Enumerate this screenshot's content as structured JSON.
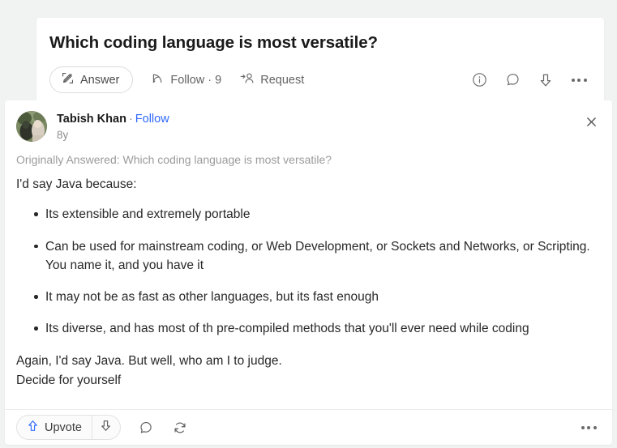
{
  "question": {
    "title": "Which coding language is most versatile?",
    "answer_button": {
      "label": "Answer",
      "icon": "pencil-edit-icon"
    },
    "follow": {
      "label": "Follow · 9",
      "icon": "rss-follow-icon",
      "count": "9"
    },
    "request": {
      "label": "Request",
      "icon": "person-add-request-icon"
    },
    "icons": {
      "info": "info-circle-icon",
      "comment": "comment-bubble-icon",
      "downvote": "downvote-arrow-icon",
      "more": "more-options-icon"
    }
  },
  "answer": {
    "author": {
      "name": "Tabish Khan",
      "separator": "·",
      "follow_label": "Follow",
      "timestamp": "8y",
      "avatar": "user-photo-avatar"
    },
    "close_icon": "close-icon",
    "originally_answered": "Originally Answered: Which coding language is most versatile?",
    "intro": "I'd say Java because:",
    "bullets": [
      "Its extensible and extremely portable",
      "Can be used for mainstream coding, or Web Development, or Sockets and Networks, or Scripting. You name it, and you have it",
      "It may not be as fast as other languages, but its fast enough",
      "Its diverse, and has most of th pre-compiled methods that you'll ever need while coding"
    ],
    "closing_line_1": "Again, I'd say Java. But well, who am I to judge.",
    "closing_line_2": "Decide for yourself",
    "footer": {
      "upvote_label": "Upvote",
      "upvote_icon": "upvote-arrow-icon",
      "downvote_icon": "downvote-arrow-icon",
      "comment_icon": "comment-bubble-icon",
      "share_icon": "repost-share-icon",
      "more_icon": "more-options-icon"
    }
  },
  "colors": {
    "page_background": "#f1f2f2",
    "card_background": "#ffffff",
    "link_blue": "#2e69ff",
    "upvote_blue": "#2e69ff",
    "body_text": "#282829",
    "muted_text": "#9b9b9b"
  }
}
